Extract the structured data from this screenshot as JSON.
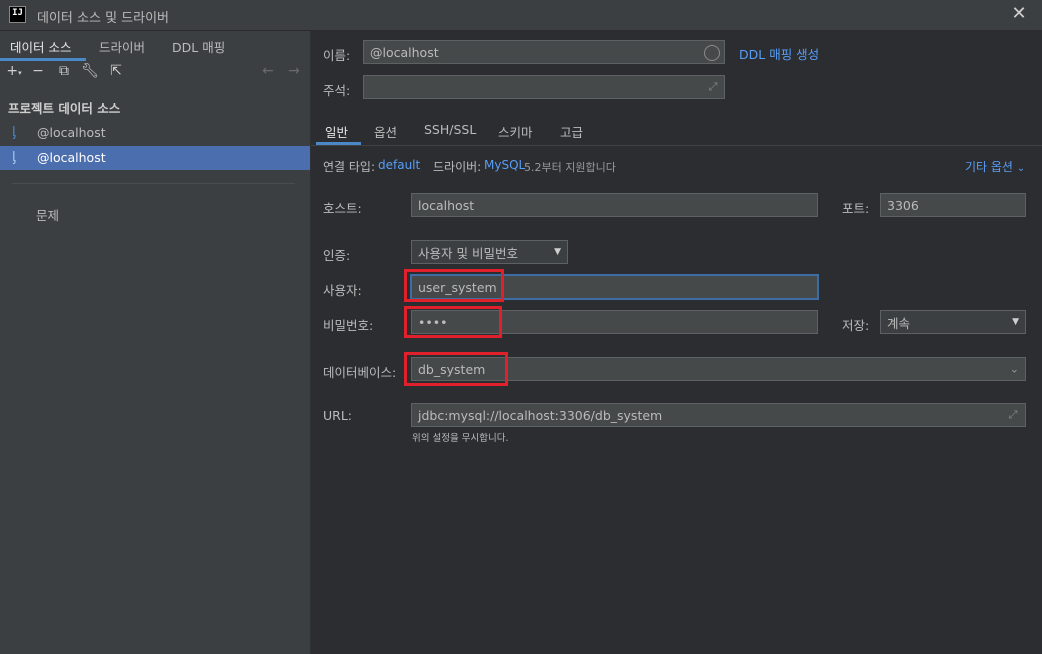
{
  "window": {
    "title": "데이터 소스 및 드라이버",
    "app_icon": "IJ"
  },
  "left": {
    "tabs": [
      {
        "label": "데이터 소스"
      },
      {
        "label": "드라이버"
      },
      {
        "label": "DDL 매핑"
      }
    ],
    "section_title": "프로젝트 데이터 소스",
    "items": [
      {
        "label": "@localhost"
      },
      {
        "label": "@localhost"
      }
    ],
    "problems_label": "문제"
  },
  "form": {
    "name_label": "이름:",
    "name_value": "@localhost",
    "ddl_link": "DDL 매핑 생성",
    "comment_label": "주석:",
    "comment_value": "",
    "tabs": [
      {
        "label": "일반"
      },
      {
        "label": "옵션"
      },
      {
        "label": "SSH/SSL"
      },
      {
        "label": "스키마"
      },
      {
        "label": "고급"
      }
    ],
    "conn_type_label": "연결 타입:",
    "conn_type_value": "default",
    "driver_label": "드라이버:",
    "driver_value": "MySQL",
    "driver_note": "5.2부터 지원합니다",
    "more_options": "기타 옵션",
    "host_label": "호스트:",
    "host_value": "localhost",
    "port_label": "포트:",
    "port_value": "3306",
    "auth_label": "인증:",
    "auth_value": "사용자 및 비밀번호",
    "user_label": "사용자:",
    "user_value": "user_system",
    "password_label": "비밀번호:",
    "password_value": "••••",
    "save_label": "저장:",
    "save_value": "계속",
    "database_label": "데이터베이스:",
    "database_value": "db_system",
    "url_label": "URL:",
    "url_value": "jdbc:mysql://localhost:3306/db_system",
    "url_note": "위의 설정을 무시합니다."
  },
  "colors": {
    "accent": "#4a88c7",
    "selection": "#4b6eaf",
    "highlight": "#e0202a",
    "link": "#589df6"
  }
}
